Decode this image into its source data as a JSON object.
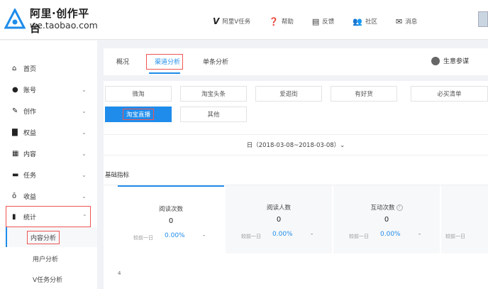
{
  "brand": {
    "title": "阿里·创作平台",
    "domain": "we.taobao.com"
  },
  "topnav": [
    {
      "label": "阿里V任务",
      "icon": "v-icon"
    },
    {
      "label": "帮助",
      "icon": "help-icon"
    },
    {
      "label": "反馈",
      "icon": "feedback-icon"
    },
    {
      "label": "社区",
      "icon": "community-icon"
    },
    {
      "label": "消息",
      "icon": "mail-icon"
    }
  ],
  "sidebar": {
    "items": [
      {
        "label": "首页",
        "icon": "home-icon",
        "chev": ""
      },
      {
        "label": "账号",
        "icon": "user-icon",
        "chev": "⌄"
      },
      {
        "label": "创作",
        "icon": "pen-icon",
        "chev": "⌄"
      },
      {
        "label": "权益",
        "icon": "document-icon",
        "chev": "⌄"
      },
      {
        "label": "内容",
        "icon": "content-icon",
        "chev": "⌄"
      },
      {
        "label": "任务",
        "icon": "briefcase-icon",
        "chev": "⌄"
      },
      {
        "label": "收益",
        "icon": "money-icon",
        "chev": "⌄"
      },
      {
        "label": "统计",
        "icon": "chart-icon",
        "chev": "⌃"
      }
    ],
    "sub": [
      {
        "label": "内容分析"
      },
      {
        "label": "用户分析"
      },
      {
        "label": "V任务分析"
      }
    ]
  },
  "tabs": [
    {
      "label": "概况"
    },
    {
      "label": "渠道分析"
    },
    {
      "label": "单条分析"
    }
  ],
  "right_link": "生意参谋",
  "channels": [
    {
      "label": "微淘"
    },
    {
      "label": "淘宝头条"
    },
    {
      "label": "爱逛街"
    },
    {
      "label": "有好货"
    },
    {
      "label": "必买清单"
    },
    {
      "label": "淘宝直播"
    },
    {
      "label": "其他"
    }
  ],
  "date_range": "日（2018-03-08~2018-03-08）⌄",
  "metrics": {
    "title": "基础指标",
    "compare_label": "较前一日",
    "cards": [
      {
        "name": "阅读次数",
        "value": "0",
        "pct": "0.00%",
        "dash": "-"
      },
      {
        "name": "阅读人数",
        "value": "0",
        "pct": "0.00%",
        "dash": "-"
      },
      {
        "name": "互动次数",
        "value": "0",
        "pct": "0.00%",
        "dash": "-"
      },
      {
        "name": "",
        "value": "",
        "pct": "",
        "dash": ""
      }
    ],
    "y_tick": "4"
  },
  "colors": {
    "accent": "#1f8ceb",
    "highlight_box": "#e55555"
  }
}
